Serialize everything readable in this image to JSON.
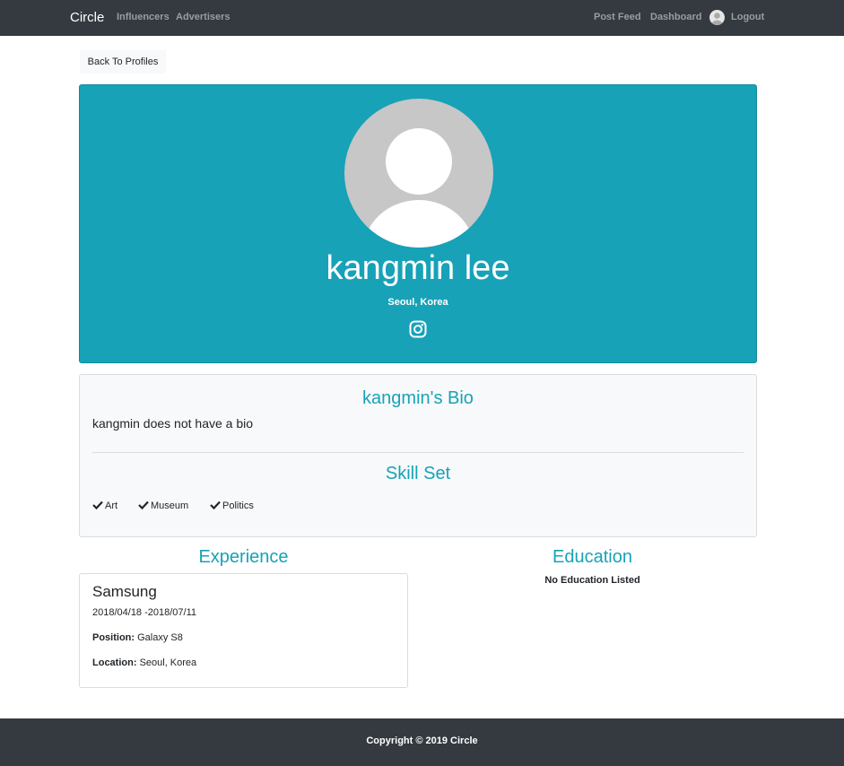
{
  "navbar": {
    "brand": "Circle",
    "left_links": [
      "Influencers",
      "Advertisers"
    ],
    "right_links": [
      "Post Feed",
      "Dashboard",
      "Logout"
    ]
  },
  "back_button": "Back To Profiles",
  "profile": {
    "name": "kangmin lee",
    "location": "Seoul, Korea",
    "social_icon": "instagram-icon",
    "accent_color": "#17a2b8"
  },
  "bio": {
    "title": "kangmin's Bio",
    "text": "kangmin does not have a bio"
  },
  "skills": {
    "title": "Skill Set",
    "items": [
      "Art",
      "Museum",
      "Politics"
    ]
  },
  "experience": {
    "title": "Experience",
    "items": [
      {
        "company": "Samsung",
        "dates": "2018/04/18 -2018/07/11",
        "position_label": "Position:",
        "position": "Galaxy S8",
        "location_label": "Location:",
        "location": "Seoul, Korea"
      }
    ]
  },
  "education": {
    "title": "Education",
    "empty_text": "No Education Listed"
  },
  "footer": {
    "text": "Copyright © 2019 Circle"
  }
}
